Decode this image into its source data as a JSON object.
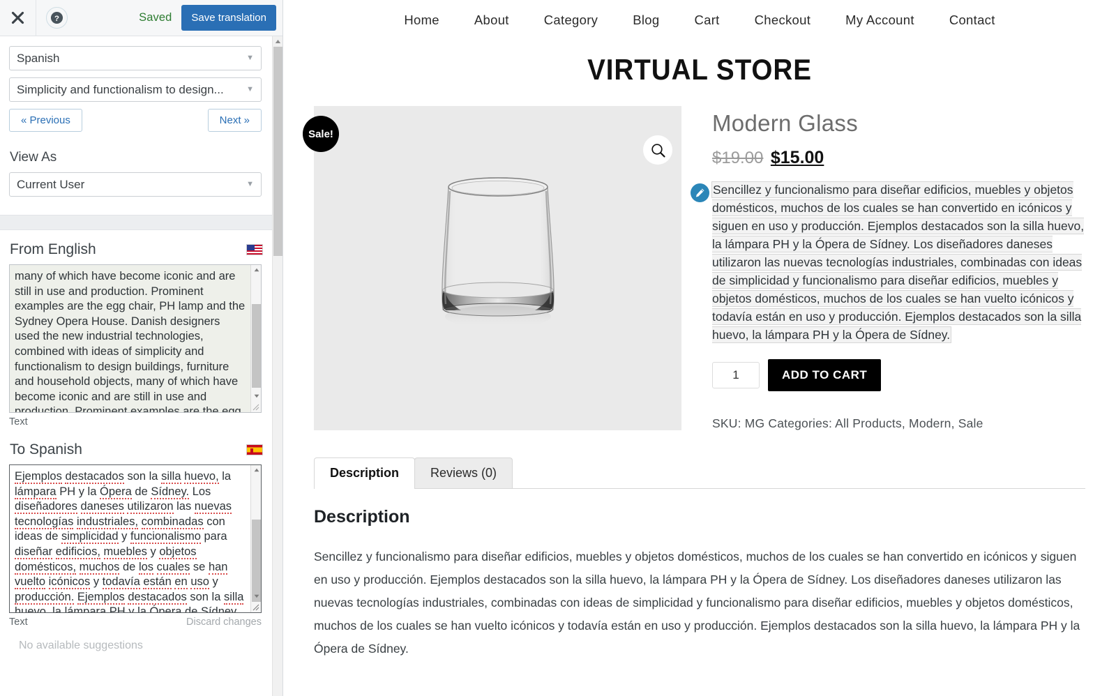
{
  "sidebar": {
    "topbar": {
      "close_icon": "close-icon",
      "help_icon": "help-icon",
      "status": "Saved",
      "save_label": "Save translation",
      "save_color": "#2a6fb5"
    },
    "language_select": "Spanish",
    "string_select": "Simplicity and functionalism to design...",
    "prev_label": "« Previous",
    "next_label": "Next »",
    "view_as_label": "View As",
    "view_as_value": "Current User",
    "source": {
      "heading": "From English",
      "flag": "us-flag-icon",
      "text": "many of which have become iconic and are still in use and production. Prominent examples are the egg chair, PH lamp and the Sydney Opera House. Danish designers used the new industrial technologies, combined with ideas of simplicity and functionalism to design buildings, furniture and household objects, many of which have become iconic and are still in use and production. Prominent examples are the egg chair, PH lamp and the",
      "footer_label": "Text"
    },
    "target": {
      "heading": "To Spanish",
      "flag": "es-flag-icon",
      "text": "Ejemplos destacados son la silla huevo, la lámpara PH y la Ópera de Sídney. Los diseñadores daneses utilizaron las nuevas tecnologías industriales, combinadas con ideas de simplicidad y funcionalismo para diseñar edificios, muebles y objetos domésticos, muchos de los cuales se han vuelto icónicos y todavía están en uso y producción. Ejemplos destacados son la silla huevo, la lámpara PH y la Ópera de Sídney.",
      "footer_label": "Text",
      "discard_label": "Discard changes",
      "suggestions": "No available suggestions"
    }
  },
  "store": {
    "nav": [
      {
        "label": "Home"
      },
      {
        "label": "About"
      },
      {
        "label": "Category"
      },
      {
        "label": "Blog"
      },
      {
        "label": "Cart"
      },
      {
        "label": "Checkout"
      },
      {
        "label": "My Account"
      },
      {
        "label": "Contact"
      }
    ],
    "logo": "VIRTUAL STORE",
    "product": {
      "sale_badge": "Sale!",
      "zoom_icon": "magnifier-icon",
      "edit_icon": "edit-pencil-icon",
      "title": "Modern Glass",
      "price_old": "$19.00",
      "price_new": "$15.00",
      "short_description": "Sencillez y funcionalismo para diseñar edificios, muebles y objetos domésticos, muchos de los cuales se han convertido en icónicos y siguen en uso y producción. Ejemplos destacados son la silla huevo, la lámpara PH y la Ópera de Sídney. Los diseñadores daneses utilizaron las nuevas tecnologías industriales, combinadas con ideas de simplicidad y funcionalismo para diseñar edificios, muebles y objetos domésticos, muchos de los cuales se han vuelto icónicos y todavía están en uso y producción. Ejemplos destacados son la silla huevo, la lámpara PH y la Ópera de Sídney.",
      "quantity": "1",
      "add_to_cart": "ADD TO CART",
      "meta": "SKU: MG Categories: All Products, Modern, Sale"
    },
    "tabs": [
      {
        "label": "Description",
        "active": true
      },
      {
        "label": "Reviews (0)",
        "active": false
      }
    ],
    "panel": {
      "heading": "Description",
      "body": "Sencillez y funcionalismo para diseñar edificios, muebles y objetos domésticos, muchos de los cuales se han convertido en icónicos y siguen en uso y producción. Ejemplos destacados son la silla huevo, la lámpara PH y la Ópera de Sídney. Los diseñadores daneses utilizaron las nuevas tecnologías industriales, combinadas con ideas de simplicidad y funcionalismo para diseñar edificios, muebles y objetos domésticos, muchos de los cuales se han vuelto icónicos y todavía están en uso y producción. Ejemplos destacados son la silla huevo, la lámpara PH y la Ópera de Sídney."
    }
  }
}
